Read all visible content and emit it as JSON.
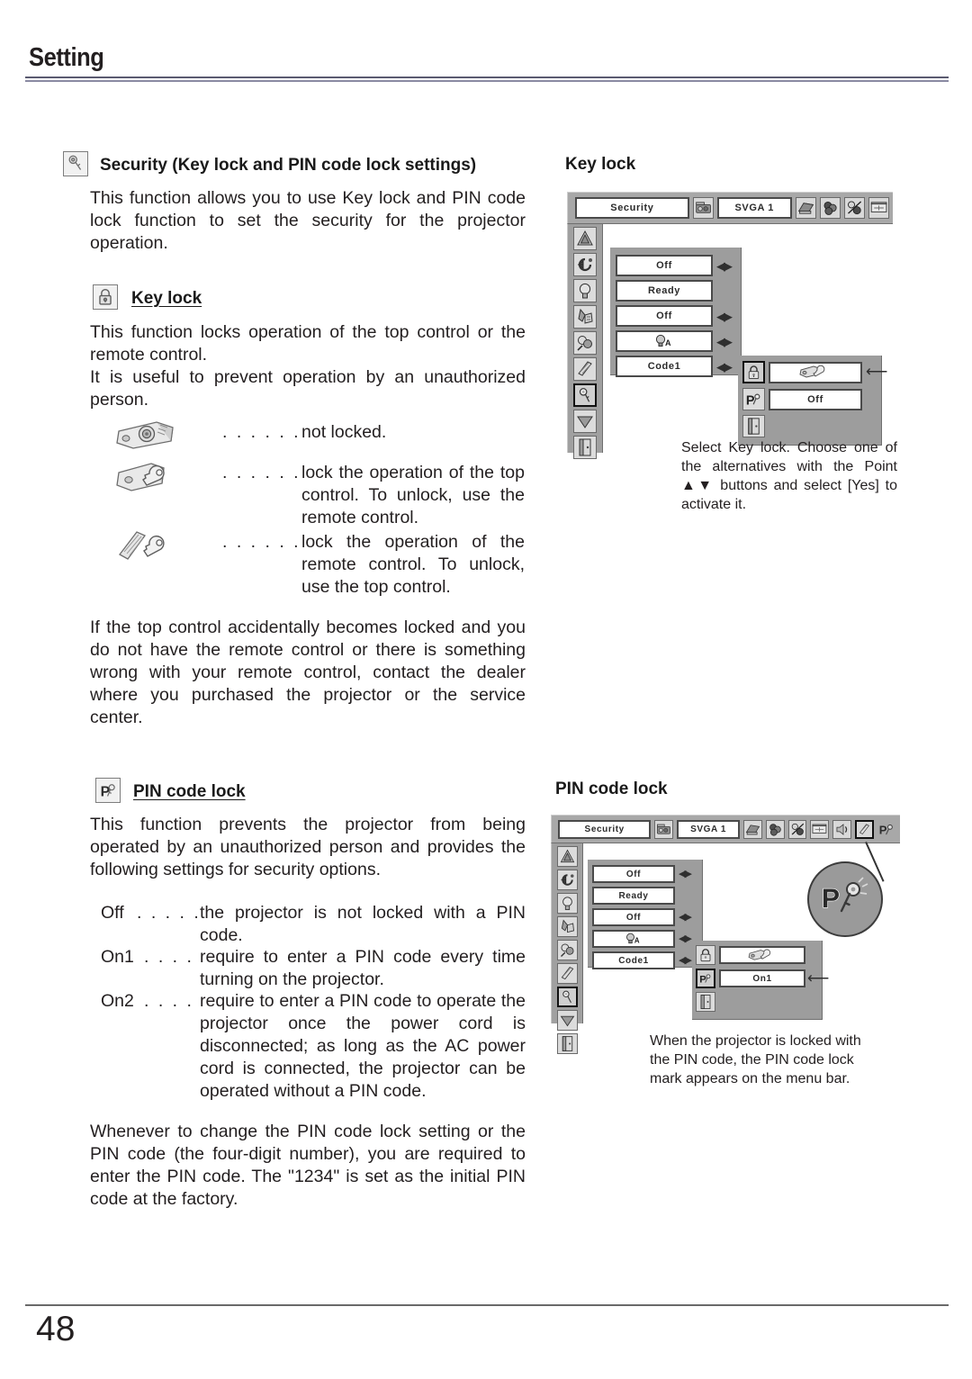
{
  "header": {
    "title": "Setting"
  },
  "footer": {
    "page_number": "48"
  },
  "left_column": {
    "security": {
      "icon": "key-icon",
      "heading": "Security (Key lock and PIN code lock settings)",
      "paragraph": "This function allows you to use Key lock and PIN code lock function to set the security for the projector operation."
    },
    "key_lock": {
      "icon": "padlock-icon",
      "heading": "Key lock",
      "paragraph_1": "This function locks operation of the top control or the remote control.",
      "paragraph_2": "It is useful to prevent operation by an unauthorized person.",
      "legend": [
        {
          "icon": "projector-unlocked-icon",
          "dots": ". . . . . .",
          "text": "not locked."
        },
        {
          "icon": "projector-key-icon",
          "dots": ". . . . . .",
          "text": "lock the operation of the top control. To unlock, use the remote control."
        },
        {
          "icon": "remote-key-icon",
          "dots": ". . . . . .",
          "text": "lock the operation of the remote control. To unlock, use the top control."
        }
      ],
      "note": "If the top control accidentally becomes locked and you do not have the remote control or there is something wrong with your remote control, contact the dealer where you purchased the projector or the service center."
    },
    "pin_code_lock": {
      "icon": "pin-key-icon",
      "heading": "PIN code lock",
      "paragraph": "This function prevents the projector from being operated by an unauthorized person and provides the following settings for security options.",
      "options": [
        {
          "key": "Off",
          "dots": ". . . . .",
          "text": "the projector is not locked with a PIN code."
        },
        {
          "key": "On1",
          "dots": ". . . .",
          "text": "require to enter a PIN code every time turning on the projector."
        },
        {
          "key": "On2",
          "dots": ". . . .",
          "text": "require to enter a PIN code to operate the projector once the power cord is disconnected;  as long as the AC power cord is connected, the projector can be operated without a PIN code."
        }
      ],
      "closing": "Whenever to change the PIN code lock setting or the PIN code (the four-digit number), you are required to enter the PIN code.  The \"1234\" is set as the initial PIN code at the factory."
    }
  },
  "right_column": {
    "key_lock_figure": {
      "title": "Key lock",
      "osd": {
        "menu_label": "Security",
        "source_label": "SVGA 1",
        "menubar_icons": [
          "input-icon",
          "pc-adjust-icon",
          "image-select-icon",
          "image-adjust-icon",
          "screen-icon"
        ],
        "sidebar_icons": [
          "language-icon",
          "auto-setup-icon",
          "lamp-control-icon",
          "filter-counter-icon",
          "fan-control-icon",
          "warning-log-icon",
          "security-icon",
          "down-arrow-icon",
          "quit-icon"
        ],
        "rows": [
          {
            "value": "Off",
            "arrows": true
          },
          {
            "value": "Ready",
            "arrows": false
          },
          {
            "value": "Off",
            "arrows": true
          },
          {
            "value": "",
            "icon": "lamp-a-icon",
            "arrows": true
          },
          {
            "value": "Code1",
            "arrows": true
          }
        ],
        "subpanel": {
          "rows": [
            {
              "icon": "padlock-icon",
              "selected": true,
              "value": "",
              "value_icon": "projector-key-icon",
              "pointer": true
            },
            {
              "icon": "pin-key-icon",
              "selected": false,
              "value": "Off",
              "pointer": false
            },
            {
              "icon": "quit-icon",
              "selected": false,
              "value": null,
              "pointer": false
            }
          ]
        }
      },
      "caption": "Select Key lock.  Choose one of the alternatives with the Point ▲▼ buttons and select [Yes] to activate it."
    },
    "pin_code_lock_figure": {
      "title": "PIN code lock",
      "osd": {
        "menu_label": "Security",
        "source_label": "SVGA 1",
        "menubar_icons": [
          "input-icon",
          "pc-adjust-icon",
          "image-select-icon",
          "image-adjust-icon",
          "screen-icon",
          "sound-icon",
          "setting-icon"
        ],
        "menubar_mark": "pin-key-icon",
        "sidebar_icons": [
          "language-icon",
          "auto-setup-icon",
          "lamp-control-icon",
          "filter-counter-icon",
          "fan-control-icon",
          "warning-log-icon",
          "security-icon",
          "down-arrow-icon",
          "quit-icon"
        ],
        "rows": [
          {
            "value": "Off",
            "arrows": true
          },
          {
            "value": "Ready",
            "arrows": false
          },
          {
            "value": "Off",
            "arrows": true
          },
          {
            "value": "",
            "icon": "lamp-a-icon",
            "arrows": true
          },
          {
            "value": "Code1",
            "arrows": true
          }
        ],
        "subpanel": {
          "rows": [
            {
              "icon": "padlock-icon",
              "selected": false,
              "value": "",
              "value_icon": "projector-key-icon",
              "pointer": false
            },
            {
              "icon": "pin-key-icon",
              "selected": true,
              "value": "On1",
              "pointer": true
            },
            {
              "icon": "quit-icon",
              "selected": false,
              "value": null,
              "pointer": false
            }
          ]
        },
        "magnifier_icon": "pin-key-icon"
      },
      "caption": "When the projector is locked with the PIN code, the PIN code lock mark appears on the menu bar."
    }
  }
}
